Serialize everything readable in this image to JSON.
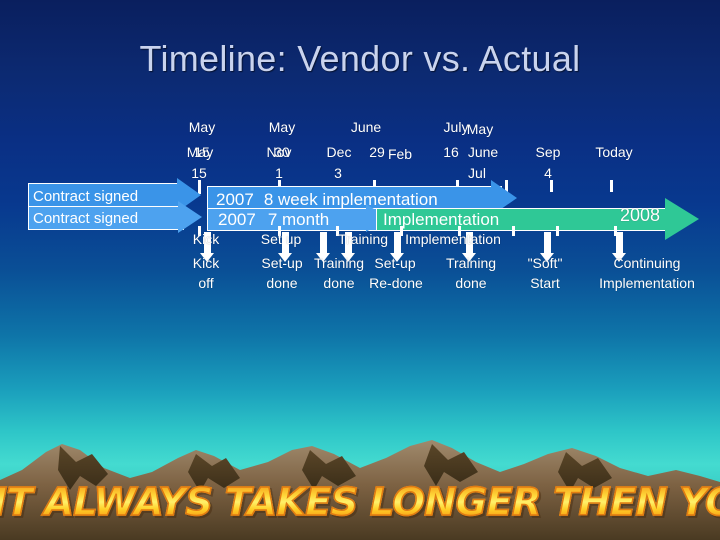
{
  "slide": {
    "title": "Timeline: Vendor vs. Actual",
    "tagline": "IT ALWAYS TAKES LONGER THEN YOU THINK",
    "colors": {
      "background_top": "#0a1f5e",
      "background_bottom": "#2bb6b8",
      "vendor_bar": "#3a94e8",
      "actual_bar": "#4da2ef",
      "actual_green_bar": "#2fc896",
      "text": "#ffffff",
      "title_text": "#c9d3ee",
      "tagline_gradient_top": "#e98310",
      "tagline_gradient_mid": "#fff06a",
      "tagline_gradient_bottom": "#e2720a"
    }
  },
  "vendor_track": {
    "start_arrow_label": "Contract signed",
    "bar_year": "2007",
    "bar_label": "8 week implementation",
    "axis_dates": [
      {
        "month": "May",
        "day": "15"
      },
      {
        "month": "May",
        "day": "30"
      },
      {
        "month": "June",
        "day": "29"
      },
      {
        "month": "July",
        "day": "16"
      }
    ],
    "milestones": [
      {
        "line1": "Kick",
        "line2": "off"
      },
      {
        "line1": "Set up",
        "line2": "done"
      },
      {
        "line1": "Training",
        "line2": "done"
      },
      {
        "line1": "Implementation",
        "line2": ""
      }
    ]
  },
  "actual_track": {
    "start_arrow_label": "Contract signed",
    "bar_year": "2007",
    "bar_label": "7 month",
    "bar_label_green": "Implementation",
    "end_year": "2008",
    "axis_dates": [
      {
        "month": "May",
        "day": "15"
      },
      {
        "month": "Nov",
        "day": "1"
      },
      {
        "month": "Dec",
        "day": "3"
      },
      {
        "month": "Feb",
        "day": ""
      },
      {
        "month": "May",
        "day": ""
      },
      {
        "month": "June",
        "day": ""
      },
      {
        "month": "Jul",
        "day": ""
      },
      {
        "month": "Sep",
        "day": "4"
      },
      {
        "month": "Today",
        "day": ""
      }
    ],
    "milestones": [
      {
        "line1": "Kick",
        "line2": "off"
      },
      {
        "line1": "Set-up",
        "line2": "done"
      },
      {
        "line1": "Training",
        "line2": "done"
      },
      {
        "line1": "Set-up",
        "line2": "Re-done"
      },
      {
        "line1": "Training",
        "line2": "done"
      },
      {
        "line1": "\"Soft\"",
        "line2": "Start"
      },
      {
        "line1": "Continuing",
        "line2": "Implementation"
      }
    ]
  }
}
